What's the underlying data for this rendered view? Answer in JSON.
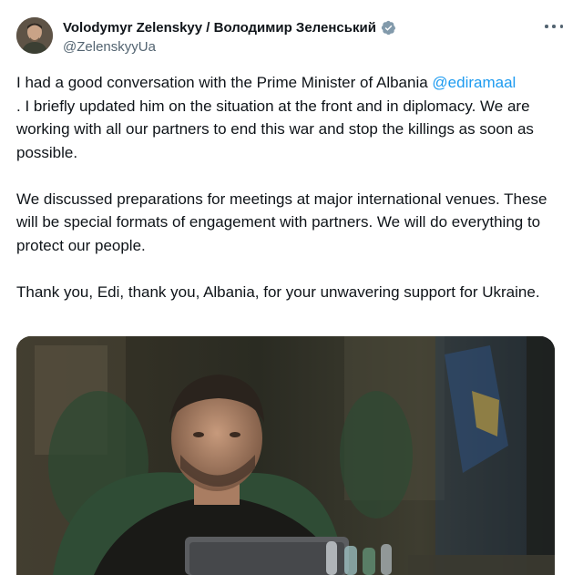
{
  "author": {
    "display_name": "Volodymyr Zelenskyy / Володимир Зеленський",
    "handle": "@ZelenskyyUa",
    "verified_icon": "verified-badge-icon",
    "more_icon": "more-options-icon"
  },
  "tweet": {
    "p1_before": "I had a good conversation with the Prime Minister of Albania ",
    "mention": "@ediramaal",
    "p1_after": ". I briefly updated him on the situation at the front and in diplomacy. We are working with all our partners to end this war and stop the killings as soon as possible.",
    "p2": "We discussed preparations for meetings at major international venues. These will be special formats of engagement with partners. We will do everything to protect our people.",
    "p3": "Thank you, Edi, thank you, Albania, for your unwavering support for Ukraine."
  },
  "colors": {
    "link": "#1d9bf0",
    "secondary_text": "#536471",
    "primary_text": "#0f1419",
    "verified": "#829aab"
  }
}
